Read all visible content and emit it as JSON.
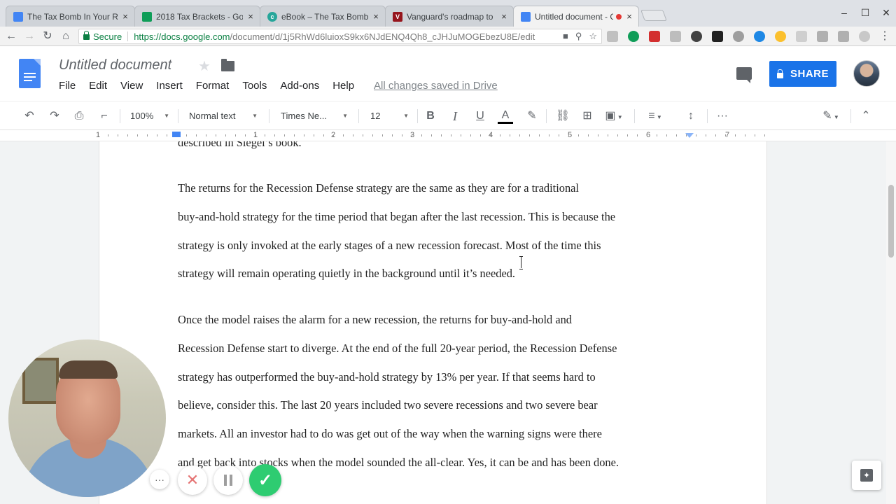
{
  "browser": {
    "tabs": [
      {
        "title": "The Tax Bomb In Your Re",
        "favicon": "docs-icon",
        "color": "#4285f4"
      },
      {
        "title": "2018 Tax Brackets - Goo",
        "favicon": "sheets-icon",
        "color": "#0f9d58"
      },
      {
        "title": "eBook – The Tax Bomb In",
        "favicon": "c-icon",
        "color": "#26a69a"
      },
      {
        "title": "Vanguard's roadmap to",
        "favicon": "vanguard-icon",
        "color": "#96151d"
      },
      {
        "title": "Untitled document - G",
        "favicon": "docs-icon",
        "color": "#4285f4"
      }
    ],
    "secure_label": "Secure",
    "url_host": "https://docs.google.com",
    "url_path": "/document/d/1j5RhWd6luioxS9kx6NJdENQ4Qh8_cJHJuMOGEbezU8E/edit"
  },
  "docs": {
    "title": "Untitled document",
    "menu": [
      "File",
      "Edit",
      "View",
      "Insert",
      "Format",
      "Tools",
      "Add-ons",
      "Help"
    ],
    "saved_status": "All changes saved in Drive",
    "share_label": "SHARE"
  },
  "toolbar": {
    "zoom": "100%",
    "style": "Normal text",
    "font": "Times Ne...",
    "size": "12"
  },
  "ruler": {
    "numbers": [
      "1",
      "1",
      "2",
      "3",
      "4",
      "5",
      "6",
      "7"
    ]
  },
  "document": {
    "partial_line": "described in Siegel’s book.",
    "paragraphs": [
      "The returns for the Recession Defense strategy are the same as they are for a traditional\nbuy-and-hold strategy for the time period that began after the last recession. This is because the\nstrategy is only invoked at the early stages of a new recession forecast. Most of the time this\nstrategy will remain operating quietly in the background until it’s needed.",
      "Once the model raises the alarm for a new recession, the returns for buy-and-hold and\nRecession Defense start to diverge. At the end of the full 20-year period, the Recession Defense\nstrategy has outperformed the buy-and-hold strategy by 13% per year. If that seems hard to\nbelieve, consider this. The last 20 years included two severe recessions and two severe bear\nmarkets. All an investor had to do was get out of the way when the warning signs were there\nand get back into stocks when the model sounded the all-clear. Yes, it can be and has been done."
    ]
  },
  "recorder": {
    "more": "···",
    "cancel": "✕",
    "done": "✓"
  }
}
